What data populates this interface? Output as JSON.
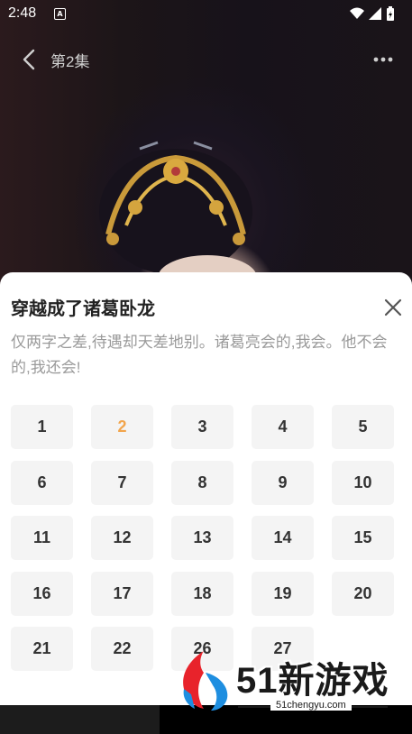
{
  "status": {
    "time": "2:48",
    "notif_letter": "A"
  },
  "nav": {
    "title": "第2集",
    "back_icon": "chevron-left-icon",
    "more_icon": "more-icon"
  },
  "sheet": {
    "title": "穿越成了诸葛卧龙",
    "description": "仅两字之差,待遇却天差地别。诸葛亮会的,我会。他不会的,我还会!",
    "close_icon": "close-icon",
    "active_episode": "2",
    "episodes": [
      "1",
      "2",
      "3",
      "4",
      "5",
      "6",
      "7",
      "8",
      "9",
      "10",
      "11",
      "12",
      "13",
      "14",
      "15",
      "16",
      "17",
      "18",
      "19",
      "20",
      "21",
      "22",
      "26",
      "27"
    ]
  },
  "watermark": {
    "brand": "51新游戏",
    "url": "51chengyu.com"
  },
  "colors": {
    "active": "#f2a54c",
    "tile_bg": "#f4f4f4"
  }
}
